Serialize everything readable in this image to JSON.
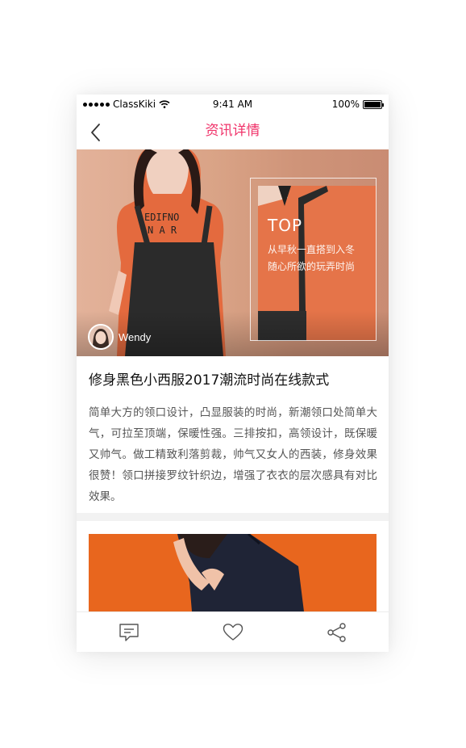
{
  "status_bar": {
    "carrier": "ClassKiki",
    "time": "9:41 AM",
    "battery": "100%",
    "battery_level": 1.0
  },
  "nav": {
    "title": "资讯详情",
    "back_icon": "chevron-left-icon"
  },
  "hero": {
    "overlay_title": "TOP",
    "overlay_line1": "从早秋一直搭到入冬",
    "overlay_line2": "随心所欲的玩弄时尚",
    "author_name": "Wendy"
  },
  "article": {
    "title": "修身黑色小西服2017潮流时尚在线款式",
    "body": "简单大方的领口设计，凸显服装的时尚，新潮领口处简单大气，可拉至顶端，保暖性强。三排按扣，高领设计，既保暖又帅气。做工精致利落剪裁，帅气又女人的西装，修身效果很赞！领口拼接罗纹针织边，增强了衣衣的层次感具有对比效果。"
  },
  "toolbar": {
    "icons": [
      "comment-icon",
      "heart-icon",
      "share-icon"
    ]
  },
  "colors": {
    "accent": "#f0336a",
    "card_bg": "#ffffff",
    "page_bg": "#f2f2f2"
  }
}
